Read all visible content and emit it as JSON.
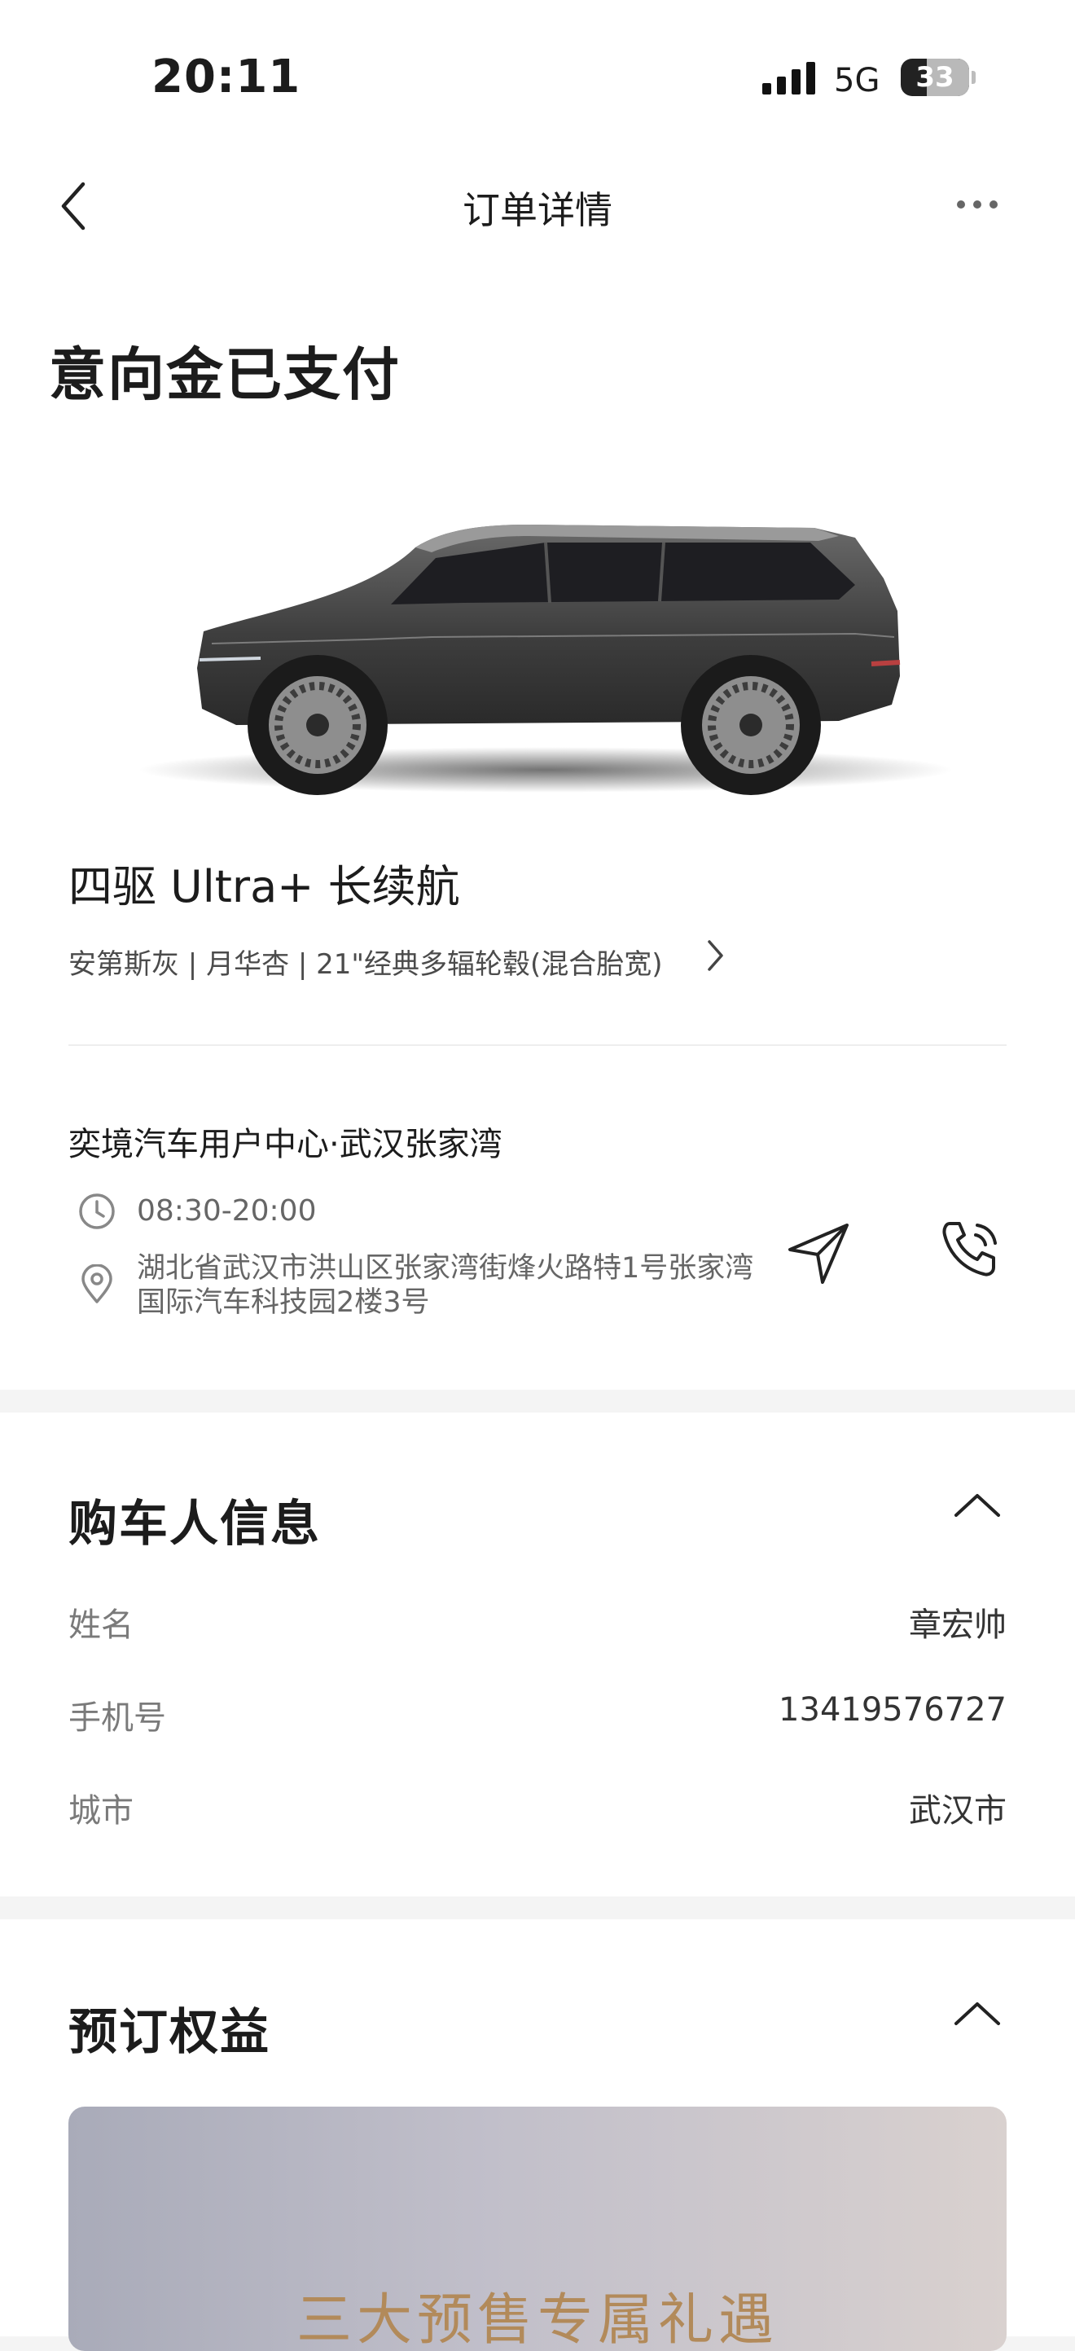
{
  "status_bar": {
    "time": "20:11",
    "network": "5G",
    "battery": "33"
  },
  "nav": {
    "title": "订单详情"
  },
  "order": {
    "status_title": "意向金已支付",
    "model_name": "四驱 Ultra+ 长续航",
    "spec": "安第斯灰 | 月华杏 | 21\"经典多辐轮毂(混合胎宽)"
  },
  "store": {
    "name": "奕境汽车用户中心·武汉张家湾",
    "hours": "08:30-20:00",
    "address": "湖北省武汉市洪山区张家湾街烽火路特1号张家湾国际汽车科技园2楼3号"
  },
  "buyer": {
    "title": "购车人信息",
    "rows": [
      {
        "label": "姓名",
        "value": "章宏帅"
      },
      {
        "label": "手机号",
        "value": "13419576727"
      },
      {
        "label": "城市",
        "value": "武汉市"
      }
    ]
  },
  "benefits": {
    "title": "预订权益",
    "banner_text": "三大预售专属礼遇"
  },
  "colors": {
    "background": "#f4f4f4",
    "card": "#ffffff",
    "banner_text": "#b28a5a"
  }
}
